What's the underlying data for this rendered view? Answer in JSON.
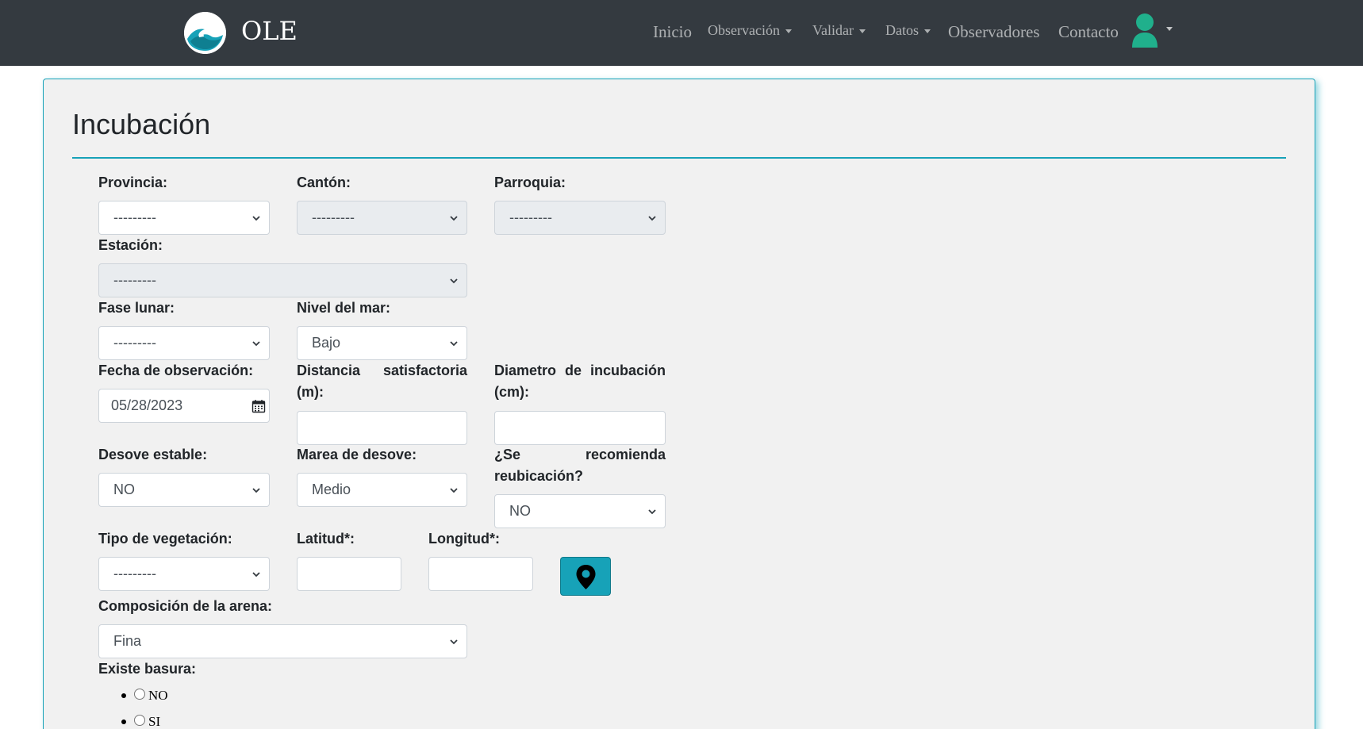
{
  "navbar": {
    "brand": "OLE",
    "items": [
      {
        "label": "Inicio",
        "dropdown": false
      },
      {
        "label": "Observación",
        "dropdown": true
      },
      {
        "label": "Validar",
        "dropdown": true
      },
      {
        "label": "Datos",
        "dropdown": true
      },
      {
        "label": "Observadores",
        "dropdown": false
      },
      {
        "label": "Contacto",
        "dropdown": false
      }
    ],
    "user_icon": "user-icon"
  },
  "form": {
    "title": "Incubación",
    "provincia": {
      "label": "Provincia:",
      "value": "---------"
    },
    "canton": {
      "label": "Cantón:",
      "value": "---------"
    },
    "parroquia": {
      "label": "Parroquia:",
      "value": "---------"
    },
    "estacion": {
      "label": "Estación:",
      "value": "---------"
    },
    "fase_lunar": {
      "label": "Fase lunar:",
      "value": "---------"
    },
    "nivel_mar": {
      "label": "Nivel del mar:",
      "value": "Bajo"
    },
    "fecha": {
      "label": "Fecha de observación:",
      "value": "05/28/2023"
    },
    "distancia": {
      "label_line1": "Distancia satisfactoria",
      "label_line2": "(m):",
      "value": ""
    },
    "diametro": {
      "label_line1": "Diametro de incubación",
      "label_line2": "(cm):",
      "value": ""
    },
    "desove_estable": {
      "label": "Desove estable:",
      "value": "NO"
    },
    "marea_desove": {
      "label": "Marea de desove:",
      "value": "Medio"
    },
    "reubicacion": {
      "label_line1": "¿Se recomienda",
      "label_line2": "reubicación?",
      "value": "NO"
    },
    "vegetacion": {
      "label": "Tipo de vegetación:",
      "value": "---------"
    },
    "latitud": {
      "label": "Latitud*:",
      "value": ""
    },
    "longitud": {
      "label": "Longitud*:",
      "value": ""
    },
    "map_button_icon": "map-marker-icon",
    "arena": {
      "label": "Composición de la arena:",
      "value": "Fina"
    },
    "basura": {
      "label": "Existe basura:",
      "options": [
        "NO",
        "SI"
      ]
    }
  },
  "colors": {
    "navbar_bg": "#343a40",
    "accent": "#17a2b8",
    "avatar": "#20b08c",
    "card_bg": "#f1f1f1"
  }
}
